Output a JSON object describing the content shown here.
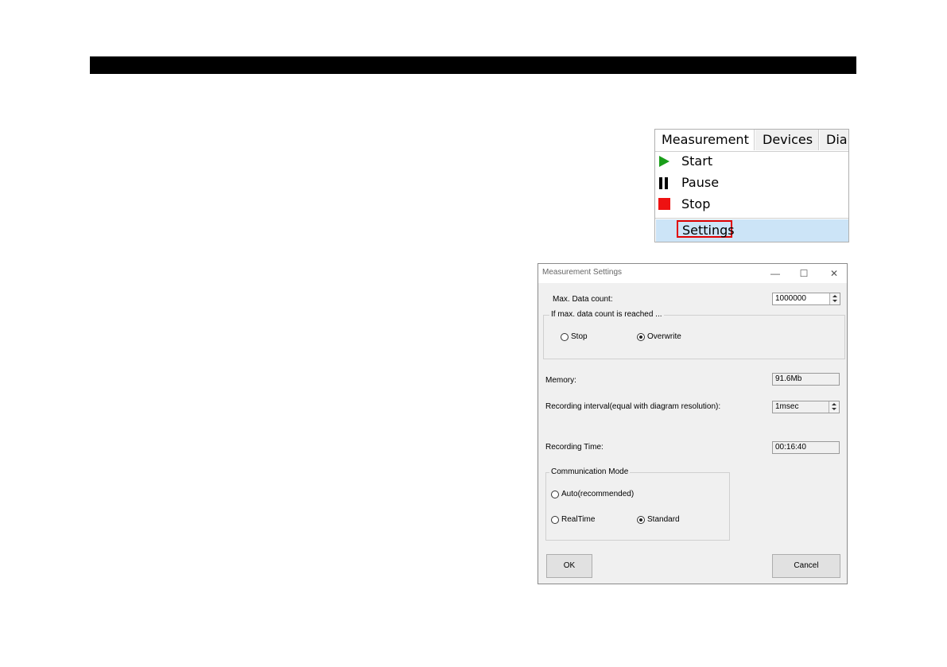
{
  "menu": {
    "bar": [
      "Measurement",
      "Devices",
      "Dia"
    ],
    "items": [
      {
        "label": "Start",
        "icon": "play-icon"
      },
      {
        "label": "Pause",
        "icon": "pause-icon"
      },
      {
        "label": "Stop",
        "icon": "stop-icon"
      }
    ],
    "settings_label": "Settings",
    "colors": {
      "start": "#1a9e1a",
      "stop": "#ee1111",
      "highlight": "#cce4f7",
      "outline": "#e00000"
    }
  },
  "dialog": {
    "title": "Measurement Settings",
    "window_buttons": {
      "minimize": "—",
      "maximize": "☐",
      "close": "✕"
    },
    "max_data_label": "Max. Data count:",
    "max_data_value": "1000000",
    "max_reached_group": "If max. data count is reached ...",
    "option_stop": "Stop",
    "option_overwrite": "Overwrite",
    "memory_label": "Memory:",
    "memory_value": "91.6Mb",
    "interval_label": "Recording interval(equal with diagram resolution):",
    "interval_value": "1msec",
    "recording_time_label": "Recording Time:",
    "recording_time_value": "00:16:40",
    "comm_group": "Communication Mode",
    "option_auto": "Auto(recommended)",
    "option_realtime": "RealTime",
    "option_standard": "Standard",
    "ok_label": "OK",
    "cancel_label": "Cancel"
  }
}
